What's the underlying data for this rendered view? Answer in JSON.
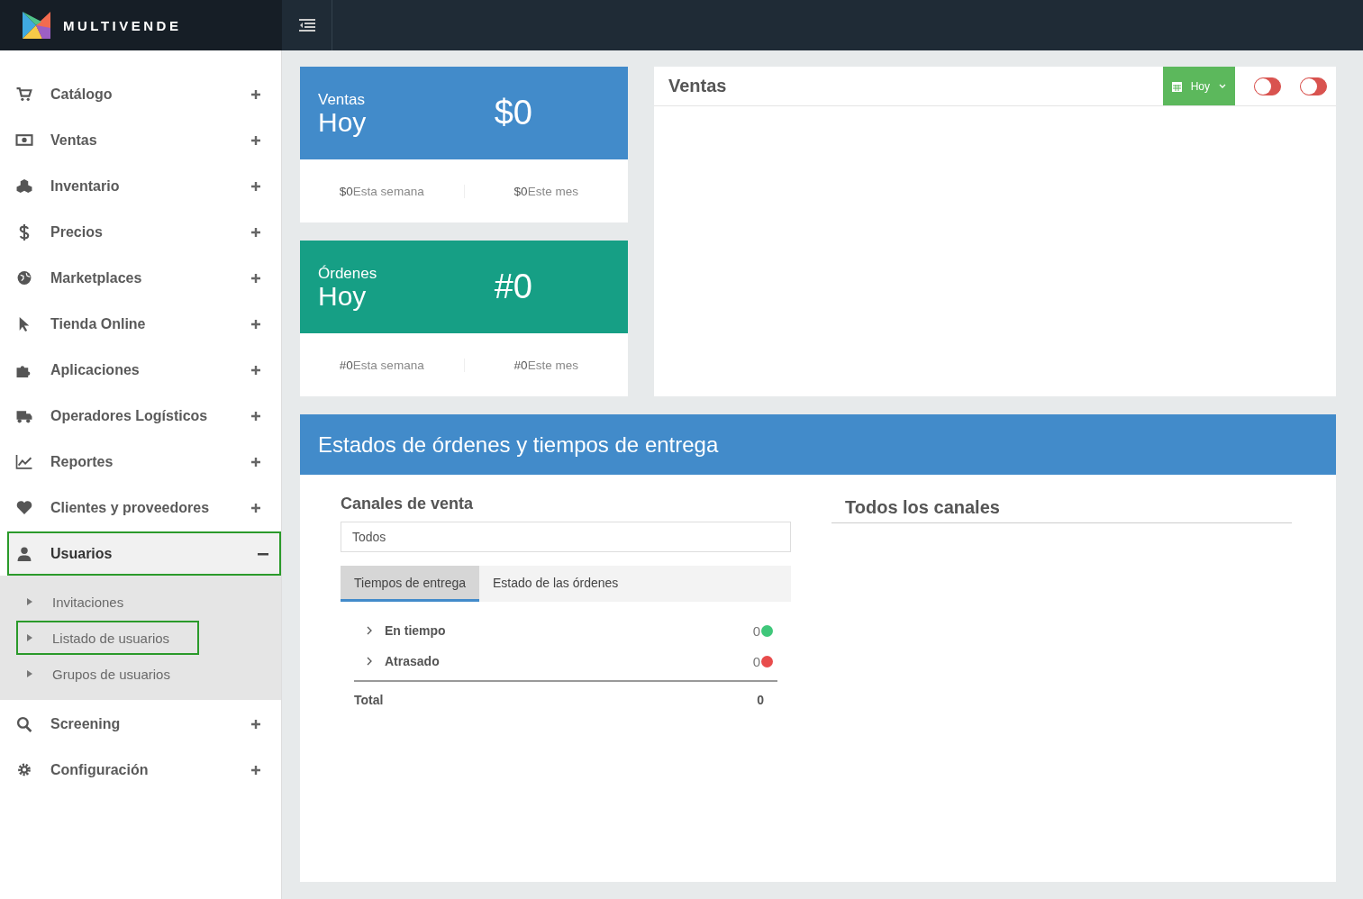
{
  "brand": {
    "name": "MULTIVENDE"
  },
  "sidebar": {
    "items": [
      {
        "label": "Catálogo",
        "expanded": false,
        "selected": false
      },
      {
        "label": "Ventas",
        "expanded": false,
        "selected": false
      },
      {
        "label": "Inventario",
        "expanded": false,
        "selected": false
      },
      {
        "label": "Precios",
        "expanded": false,
        "selected": false
      },
      {
        "label": "Marketplaces",
        "expanded": false,
        "selected": false
      },
      {
        "label": "Tienda Online",
        "expanded": false,
        "selected": false
      },
      {
        "label": "Aplicaciones",
        "expanded": false,
        "selected": false
      },
      {
        "label": "Operadores Logísticos",
        "expanded": false,
        "selected": false
      },
      {
        "label": "Reportes",
        "expanded": false,
        "selected": false
      },
      {
        "label": "Clientes y proveedores",
        "expanded": false,
        "selected": false
      },
      {
        "label": "Usuarios",
        "expanded": true,
        "selected": true,
        "children": [
          {
            "label": "Invitaciones",
            "selected": false
          },
          {
            "label": "Listado de usuarios",
            "selected": true
          },
          {
            "label": "Grupos de usuarios",
            "selected": false
          }
        ]
      },
      {
        "label": "Screening",
        "expanded": false,
        "selected": false
      },
      {
        "label": "Configuración",
        "expanded": false,
        "selected": false
      }
    ]
  },
  "stat_cards": [
    {
      "title": "Ventas",
      "period": "Hoy",
      "value": "$0",
      "color": "#428bca",
      "footer": [
        {
          "value": "$0",
          "label": "Esta semana"
        },
        {
          "value": "$0",
          "label": "Este mes"
        }
      ]
    },
    {
      "title": "Órdenes",
      "period": "Hoy",
      "value": "#0",
      "color": "#169f85",
      "footer": [
        {
          "value": "#0",
          "label": "Esta semana"
        },
        {
          "value": "#0",
          "label": "Este mes"
        }
      ]
    }
  ],
  "sales_panel": {
    "title": "Ventas",
    "date_button": "Hoy",
    "toggles": [
      {
        "on": false
      },
      {
        "on": false
      }
    ]
  },
  "orders_section": {
    "title": "Estados de órdenes y tiempos de entrega",
    "channels_label": "Canales de venta",
    "channel_select": "Todos",
    "tabs": [
      {
        "label": "Tiempos de entrega",
        "selected": true
      },
      {
        "label": "Estado de las órdenes",
        "selected": false
      }
    ],
    "rows": [
      {
        "label": "En tiempo",
        "count": "0",
        "color": "#3fc77a"
      },
      {
        "label": "Atrasado",
        "count": "0",
        "color": "#e84c4c"
      }
    ],
    "total_label": "Total",
    "total_value": "0",
    "right_heading": "Todos los canales"
  }
}
